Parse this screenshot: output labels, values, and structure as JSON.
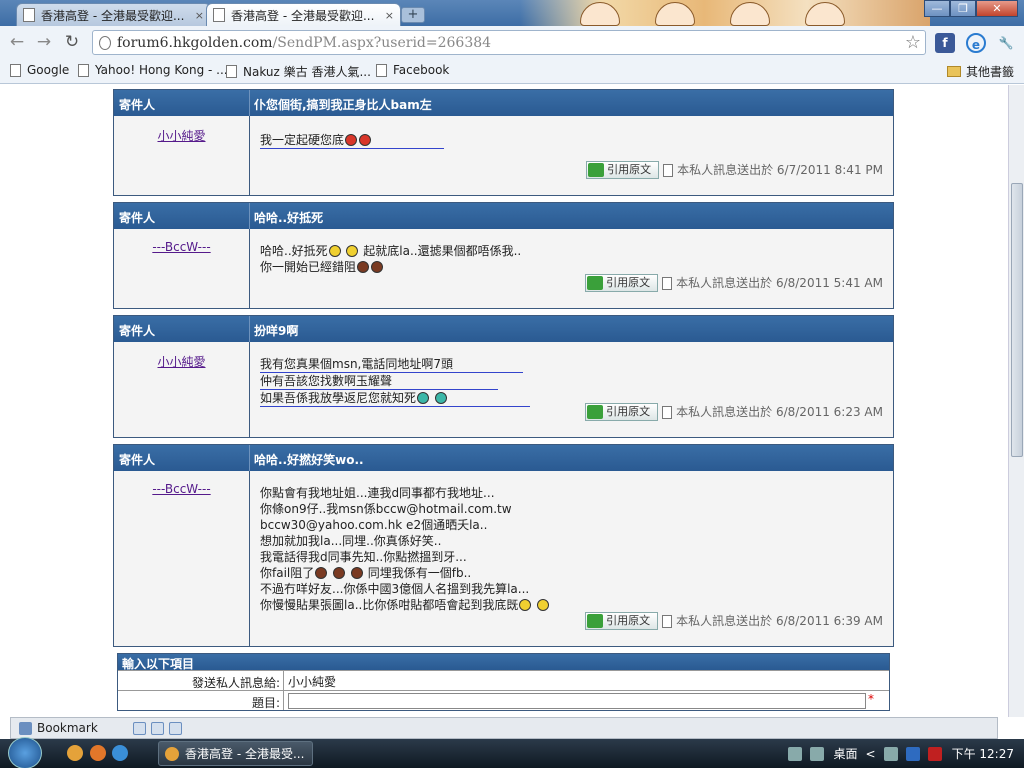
{
  "browser": {
    "tabs": [
      {
        "label": "香港高登 - 全港最受歡迎...",
        "close": "×"
      },
      {
        "label": "香港高登 - 全港最受歡迎...",
        "close": "×"
      }
    ],
    "new_tab": "+",
    "url_host": "forum6.hkgolden.com",
    "url_path": "/SendPM.aspx?userid=266384",
    "bookmarks": [
      "Google",
      "Yahoo! Hong Kong - ...",
      "Nakuz 樂古 香港人氣...",
      "Facebook"
    ],
    "other_bookmarks": "其他書籤"
  },
  "header_sender_label": "寄件人",
  "messages": [
    {
      "title": "仆您個街,搞到我正身比人bam左",
      "sender": "小小純愛",
      "lines": [
        "我一定起硬您底"
      ],
      "quote_label": "引用原文",
      "sent": "本私人訊息送出於 6/7/2011 8:41 PM"
    },
    {
      "title": "哈哈..好抵死",
      "sender": "---BccW---",
      "lines": [
        "哈哈..好抵死",
        "起就底la..還摅果個都唔係我..",
        "你一開始已經錯阻"
      ],
      "quote_label": "引用原文",
      "sent": "本私人訊息送出於 6/8/2011 5:41 AM"
    },
    {
      "title": "扮咩9啊",
      "sender": "小小純愛",
      "lines": [
        "我有您真果個msn,電話同地址啊7頭",
        "仲有吾該您找數啊玉耀聲",
        "如果吾係我放學返尼您就知死"
      ],
      "quote_label": "引用原文",
      "sent": "本私人訊息送出於 6/8/2011 6:23 AM"
    },
    {
      "title": "哈哈..好撚好笑wo..",
      "sender": "---BccW---",
      "lines": [
        "你點會有我地址姐...連我d同事都冇我地址...",
        "你條on9仔..我msn係bccw@hotmail.com.tw",
        "bccw30@yahoo.com.hk e2個通晒夭la..",
        "想加就加我la...同埋..你真係好笑..",
        "我電話得我d同事先知..你點撚搵到牙...",
        "你fail阻了",
        "同埋我係有一個fb..",
        "不過冇咩好友...你係中國3億個人名搵到我先算la...",
        "你慢慢貼果張圖la..比你係咁貼都唔會起到我底既"
      ],
      "quote_label": "引用原文",
      "sent": "本私人訊息送出於 6/8/2011 6:39 AM"
    }
  ],
  "form": {
    "heading": "輸入以下項目",
    "recipient_label": "發送私人訊息給:",
    "recipient_value": "小小純愛",
    "subject_label": "題目:",
    "subject_value": "",
    "required_mark": "*"
  },
  "bottom_bar": {
    "label": "Bookmark"
  },
  "taskbar": {
    "task_label": "香港高登 - 全港最受...",
    "desktop_label": "桌面",
    "clock": "下午 12:27",
    "tray_arrow": "<"
  }
}
